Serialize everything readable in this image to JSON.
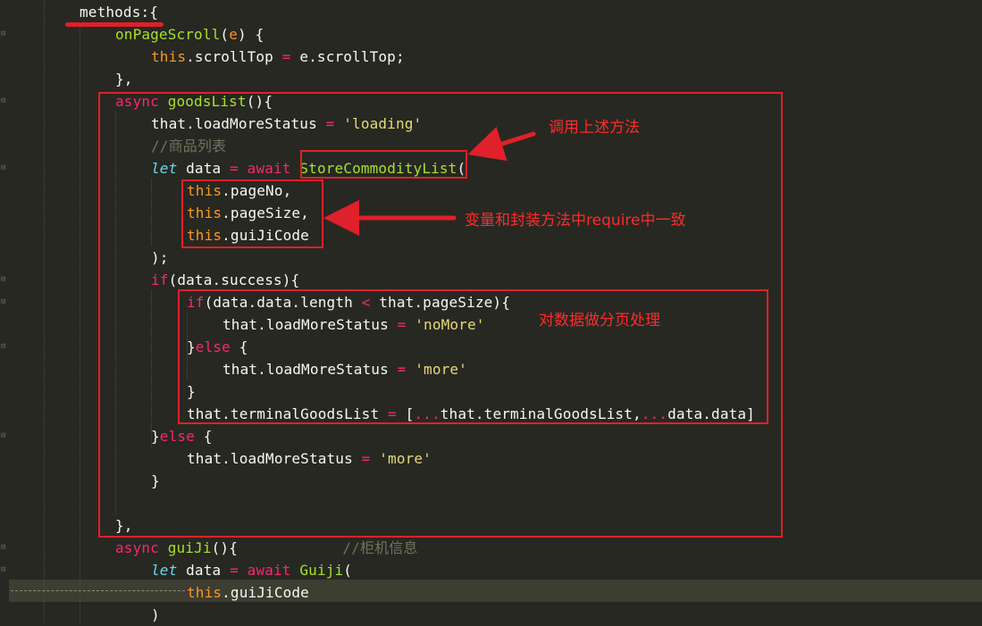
{
  "editor": {
    "lines": [
      [
        [
          "w",
          "methods:{"
        ]
      ],
      [
        [
          "f",
          "onPageScroll"
        ],
        [
          "w",
          "("
        ],
        [
          "t",
          "e"
        ],
        [
          "w",
          ") {"
        ]
      ],
      [
        [
          "t",
          "this"
        ],
        [
          "w",
          ".scrollTop "
        ],
        [
          "k",
          "="
        ],
        [
          "w",
          " e.scrollTop;"
        ]
      ],
      [
        [
          "w",
          "},"
        ]
      ],
      [
        [
          "k",
          "async "
        ],
        [
          "f",
          "goodsList"
        ],
        [
          "w",
          "(){"
        ]
      ],
      [
        [
          "w",
          "that.loadMoreStatus "
        ],
        [
          "k",
          "="
        ],
        [
          "w",
          " "
        ],
        [
          "s",
          "'loading'"
        ]
      ],
      [
        [
          "c",
          "//商品列表"
        ]
      ],
      [
        [
          "kb",
          "let"
        ],
        [
          "w",
          " data "
        ],
        [
          "k",
          "="
        ],
        [
          "w",
          " "
        ],
        [
          "k",
          "await"
        ],
        [
          "w",
          " "
        ],
        [
          "f",
          "StoreCommodityList"
        ],
        [
          "w",
          "("
        ]
      ],
      [
        [
          "t",
          "this"
        ],
        [
          "w",
          ".pageNo,"
        ]
      ],
      [
        [
          "t",
          "this"
        ],
        [
          "w",
          ".pageSize,"
        ]
      ],
      [
        [
          "t",
          "this"
        ],
        [
          "w",
          ".guiJiCode"
        ]
      ],
      [
        [
          "w",
          ");"
        ]
      ],
      [
        [
          "k",
          "if"
        ],
        [
          "w",
          "(data.success){"
        ]
      ],
      [
        [
          "k",
          "if"
        ],
        [
          "w",
          "(data.data.length "
        ],
        [
          "k",
          "<"
        ],
        [
          "w",
          " that.pageSize){"
        ]
      ],
      [
        [
          "w",
          "that.loadMoreStatus "
        ],
        [
          "k",
          "="
        ],
        [
          "w",
          " "
        ],
        [
          "s",
          "'noMore'"
        ]
      ],
      [
        [
          "w",
          "}"
        ],
        [
          "k",
          "else"
        ],
        [
          "w",
          " {"
        ]
      ],
      [
        [
          "w",
          "that.loadMoreStatus "
        ],
        [
          "k",
          "="
        ],
        [
          "w",
          " "
        ],
        [
          "s",
          "'more'"
        ]
      ],
      [
        [
          "w",
          "}"
        ]
      ],
      [
        [
          "w",
          "that.terminalGoodsList "
        ],
        [
          "k",
          "="
        ],
        [
          "w",
          " ["
        ],
        [
          "k",
          "..."
        ],
        [
          "w",
          "that.terminalGoodsList,"
        ],
        [
          "k",
          "..."
        ],
        [
          "w",
          "data.data]"
        ]
      ],
      [
        [
          "w",
          "}"
        ],
        [
          "k",
          "else"
        ],
        [
          "w",
          " {"
        ]
      ],
      [
        [
          "w",
          "that.loadMoreStatus "
        ],
        [
          "k",
          "="
        ],
        [
          "w",
          " "
        ],
        [
          "s",
          "'more'"
        ]
      ],
      [
        [
          "w",
          "}"
        ]
      ],
      [],
      [
        [
          "w",
          "},"
        ]
      ],
      [
        [
          "k",
          "async "
        ],
        [
          "f",
          "guiJi"
        ],
        [
          "w",
          "(){            "
        ],
        [
          "c",
          "//柜机信息"
        ]
      ],
      [
        [
          "kb",
          "let"
        ],
        [
          "w",
          " data "
        ],
        [
          "k",
          "="
        ],
        [
          "w",
          " "
        ],
        [
          "k",
          "await"
        ],
        [
          "w",
          " "
        ],
        [
          "f",
          "Guiji"
        ],
        [
          "w",
          "("
        ]
      ],
      [
        [
          "t",
          "this"
        ],
        [
          "w",
          ".guiJiCode"
        ]
      ],
      [
        [
          "w",
          ")"
        ]
      ]
    ]
  },
  "annotations": {
    "call_method": "调用上述方法",
    "vars_consistent": "变量和封装方法中require中一致",
    "paging": "对数据做分页处理"
  },
  "colors": {
    "background": "#272822",
    "annotation": "#e0202a"
  }
}
